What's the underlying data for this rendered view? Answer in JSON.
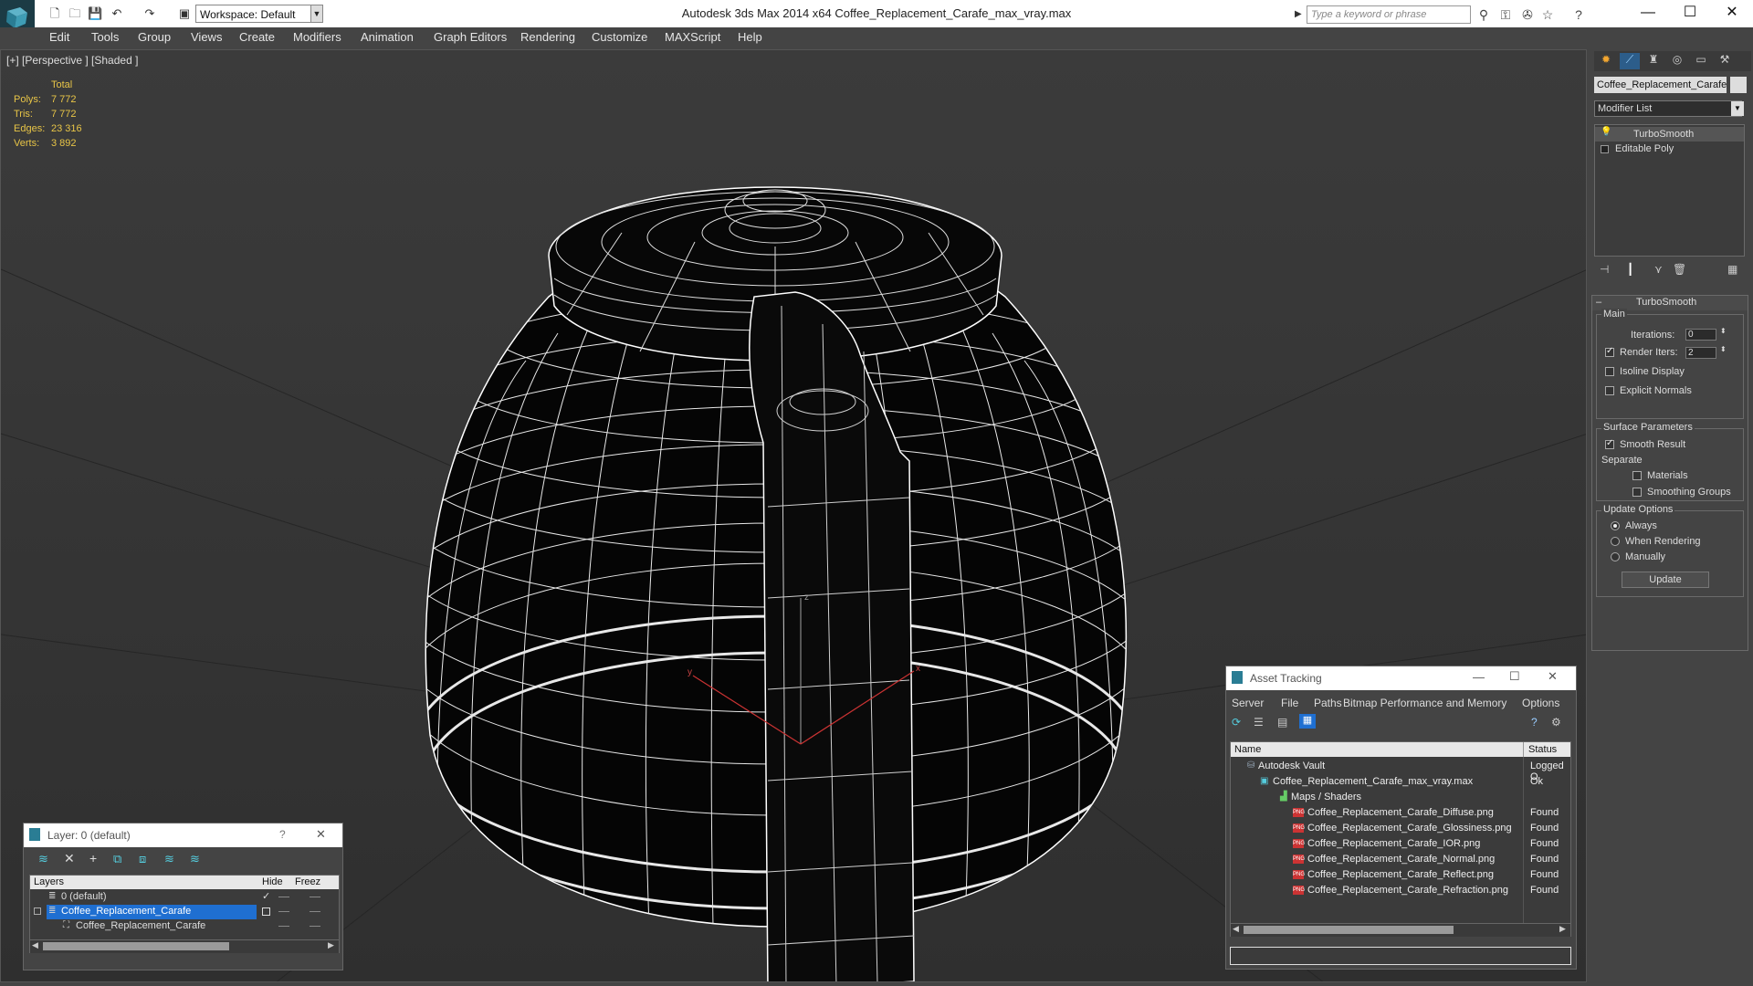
{
  "titlebar": {
    "app_title": "Autodesk 3ds Max  2014 x64      Coffee_Replacement_Carafe_max_vray.max",
    "workspace": "Workspace: Default",
    "search_placeholder": "Type a keyword or phrase"
  },
  "menu": [
    "Edit",
    "Tools",
    "Group",
    "Views",
    "Create",
    "Modifiers",
    "Animation",
    "Graph Editors",
    "Rendering",
    "Customize",
    "MAXScript",
    "Help"
  ],
  "viewport": {
    "label": "[+] [Perspective ] [Shaded ]",
    "stats": {
      "header": "Total",
      "rows": [
        {
          "label": "Polys:",
          "value": "7 772"
        },
        {
          "label": "Tris:",
          "value": "7 772"
        },
        {
          "label": "Edges:",
          "value": "23 316"
        },
        {
          "label": "Verts:",
          "value": "3 892"
        }
      ]
    },
    "gizmo_labels": {
      "z": "z",
      "x": "x",
      "y": "y"
    }
  },
  "command_panel": {
    "object_name": "Coffee_Replacement_Carafe",
    "modifier_list": "Modifier List",
    "stack": [
      "TurboSmooth",
      "Editable Poly"
    ],
    "rollout_title": "TurboSmooth",
    "main_label": "Main",
    "iterations_label": "Iterations:",
    "iterations_value": "0",
    "render_iters_label": "Render Iters:",
    "render_iters_value": "2",
    "isoline": "Isoline Display",
    "explicit_normals": "Explicit Normals",
    "surface_params": "Surface Parameters",
    "smooth_result": "Smooth Result",
    "separate": "Separate",
    "materials": "Materials",
    "smoothing_groups": "Smoothing Groups",
    "update_options": "Update Options",
    "always": "Always",
    "when_rendering": "When Rendering",
    "manually": "Manually",
    "update_button": "Update"
  },
  "asset_tracking": {
    "title": "Asset Tracking",
    "menu": [
      "Server",
      "File",
      "Paths",
      "Bitmap Performance and Memory",
      "Options"
    ],
    "columns": {
      "name": "Name",
      "status": "Status"
    },
    "rows": [
      {
        "name": "Autodesk Vault",
        "status": "Logged O"
      },
      {
        "name": "Coffee_Replacement_Carafe_max_vray.max",
        "status": "Ok"
      },
      {
        "name": "Maps / Shaders",
        "status": ""
      },
      {
        "name": "Coffee_Replacement_Carafe_Diffuse.png",
        "status": "Found"
      },
      {
        "name": "Coffee_Replacement_Carafe_Glossiness.png",
        "status": "Found"
      },
      {
        "name": "Coffee_Replacement_Carafe_IOR.png",
        "status": "Found"
      },
      {
        "name": "Coffee_Replacement_Carafe_Normal.png",
        "status": "Found"
      },
      {
        "name": "Coffee_Replacement_Carafe_Reflect.png",
        "status": "Found"
      },
      {
        "name": "Coffee_Replacement_Carafe_Refraction.png",
        "status": "Found"
      }
    ],
    "png_badge": "PNG"
  },
  "layer_window": {
    "title": "Layer: 0 (default)",
    "help": "?",
    "columns": {
      "layers": "Layers",
      "hide": "Hide",
      "freeze": "Freez"
    },
    "rows": [
      {
        "name": "0 (default)"
      },
      {
        "name": "Coffee_Replacement_Carafe"
      },
      {
        "name": "Coffee_Replacement_Carafe"
      }
    ]
  },
  "colors": {
    "selection": "#1f6fd1",
    "stats": "#e8c547",
    "wire": "#ffffff"
  }
}
